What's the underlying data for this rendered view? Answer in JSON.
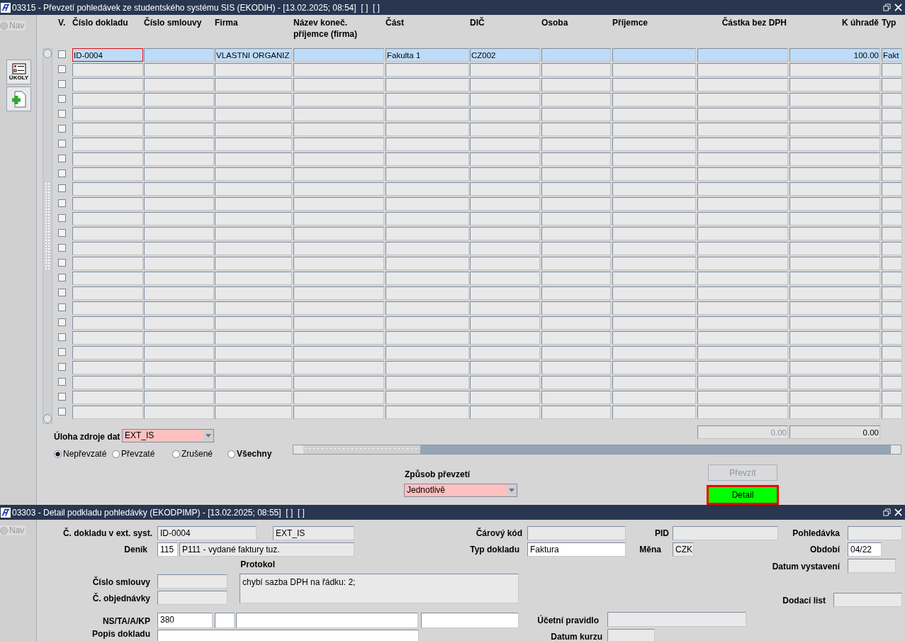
{
  "main_window": {
    "title": "03315 - Převzetí pohledávek ze studentského systému SIS (EKODIH) - [13.02.2025; 08:54]  [ ]  [ ]",
    "nav_label": "Nav",
    "nav_selected": false,
    "tasks_icon_label": "ÚKOLY",
    "columns": [
      "V.",
      "Číslo dokladu",
      "Číslo smlouvy",
      "Firma",
      "Název koneč. příjemce (firma)",
      "Část",
      "DIČ",
      "Osoba",
      "Příjemce",
      "Částka bez DPH",
      "K úhradě",
      "Typ"
    ],
    "rows": [
      {
        "selected": true,
        "checked": false,
        "focused": true,
        "cislo_dokladu": "ID-0004",
        "firma": "VLASTNI ORGANIZ",
        "cast": "Fakulta 1",
        "dic": "CZ002",
        "k_uhrade": "100.00",
        "typ": "Fakt"
      },
      {
        "selected": false,
        "checked": false,
        "focused": false
      },
      {
        "selected": false,
        "checked": false,
        "focused": false
      },
      {
        "selected": false,
        "checked": false,
        "focused": false
      },
      {
        "selected": false,
        "checked": false,
        "focused": false
      },
      {
        "selected": false,
        "checked": false,
        "focused": false
      },
      {
        "selected": false,
        "checked": false,
        "focused": false
      },
      {
        "selected": false,
        "checked": false,
        "focused": false
      },
      {
        "selected": false,
        "checked": false,
        "focused": false
      },
      {
        "selected": false,
        "checked": false,
        "focused": false
      },
      {
        "selected": false,
        "checked": false,
        "focused": false
      },
      {
        "selected": false,
        "checked": false,
        "focused": false
      },
      {
        "selected": false,
        "checked": false,
        "focused": false
      },
      {
        "selected": false,
        "checked": false,
        "focused": false
      },
      {
        "selected": false,
        "checked": false,
        "focused": false
      },
      {
        "selected": false,
        "checked": false,
        "focused": false
      },
      {
        "selected": false,
        "checked": false,
        "focused": false
      },
      {
        "selected": false,
        "checked": false,
        "focused": false
      },
      {
        "selected": false,
        "checked": false,
        "focused": false
      },
      {
        "selected": false,
        "checked": false,
        "focused": false
      },
      {
        "selected": false,
        "checked": false,
        "focused": false
      },
      {
        "selected": false,
        "checked": false,
        "focused": false
      },
      {
        "selected": false,
        "checked": false,
        "focused": false
      },
      {
        "selected": false,
        "checked": false,
        "focused": false
      },
      {
        "selected": false,
        "checked": false,
        "focused": false
      }
    ],
    "totals": [
      {
        "value": "0.00",
        "disabled": true
      },
      {
        "value": "0.00",
        "disabled": false
      }
    ],
    "source_task": {
      "label": "Úloha zdroje dat",
      "value": "EXT_IS"
    },
    "filters": [
      {
        "label": "Nepřevzaté",
        "selected": true,
        "emphasized": false
      },
      {
        "label": "Převzaté",
        "selected": false,
        "emphasized": false
      },
      {
        "label": "Zrušené",
        "selected": false,
        "emphasized": false
      },
      {
        "label": "Všechny",
        "selected": false,
        "emphasized": true
      }
    ],
    "transfer_mode": {
      "label": "Způsob převzetí",
      "value": "Jednotlivě"
    },
    "buttons": [
      {
        "label": "Převzít",
        "disabled": true,
        "focused": false
      },
      {
        "label": "Detail",
        "disabled": false,
        "focused": true
      }
    ]
  },
  "detail_window": {
    "title": "03303 - Detail podkladu pohledávky (EKODPIMP) - [13.02.2025; 08:55]  [ ]  [ ]",
    "nav_label": "Nav",
    "nav_selected": false,
    "fields": [
      {
        "label": "Č. dokladu v ext. syst.",
        "inputs": [
          {
            "value": "ID-0004",
            "editable": false
          },
          {
            "value": "EXT_IS",
            "editable": false
          }
        ]
      },
      {
        "label": "Čárový kód",
        "inputs": [
          {
            "editable": false
          }
        ]
      },
      {
        "label": "PID",
        "inputs": [
          {
            "editable": false
          }
        ]
      },
      {
        "label": "Pohledávka",
        "inputs": [
          {
            "editable": false
          }
        ]
      },
      {
        "label": "Deník",
        "inputs": [
          {
            "value": "115",
            "editable": true
          },
          {
            "value": "P111 - vydané faktury tuz.",
            "editable": false
          }
        ]
      },
      {
        "label": "Typ dokladu",
        "inputs": [
          {
            "value": "Faktura",
            "editable": true
          }
        ]
      },
      {
        "label": "Měna",
        "inputs": [
          {
            "value": "CZK",
            "editable": false
          }
        ]
      },
      {
        "label": "Období",
        "inputs": [
          {
            "value": "04/22",
            "editable": true
          }
        ]
      },
      {
        "label": "Protokol",
        "inputs": [
          {
            "value": "chybí sazba DPH na řádku: 2;",
            "editable": false
          }
        ]
      },
      {
        "label": "Datum vystavení",
        "inputs": [
          {
            "editable": false
          }
        ]
      },
      {
        "label": "Číslo smlouvy",
        "inputs": [
          {
            "editable": false
          }
        ]
      },
      {
        "label": "Č. objednávky",
        "inputs": [
          {
            "editable": false
          }
        ]
      },
      {
        "label": "Dodací list",
        "inputs": [
          {
            "editable": false
          }
        ]
      },
      {
        "label": "NS/TA/A/KP",
        "inputs": [
          {
            "value": "380",
            "editable": true
          },
          {
            "editable": true
          },
          {
            "editable": true
          },
          {
            "editable": true
          }
        ]
      },
      {
        "label": "Účetní pravidlo",
        "inputs": [
          {
            "editable": false
          }
        ]
      },
      {
        "label": "Popis dokladu",
        "inputs": [
          {
            "editable": true
          }
        ]
      },
      {
        "label": "Datum kurzu",
        "inputs": [
          {
            "editable": false
          }
        ]
      }
    ]
  }
}
